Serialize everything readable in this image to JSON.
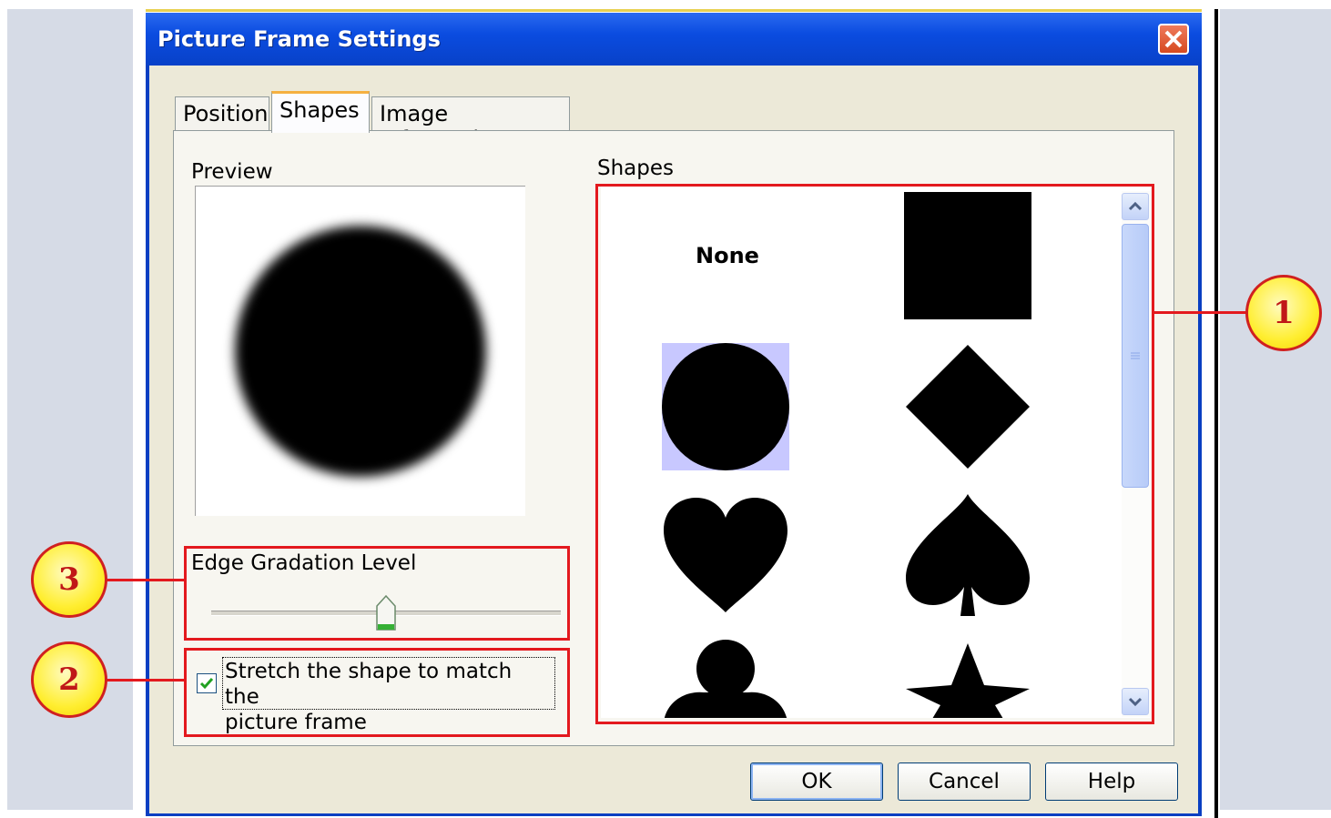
{
  "dialog": {
    "title": "Picture Frame Settings"
  },
  "tabs": [
    {
      "label": "Position",
      "active": false
    },
    {
      "label": "Shapes",
      "active": true
    },
    {
      "label": "Image Information",
      "active": false
    }
  ],
  "preview": {
    "label": "Preview"
  },
  "gradation": {
    "label": "Edge Gradation Level",
    "level_fraction": 0.5
  },
  "stretch": {
    "label_line1": "Stretch the shape to match the",
    "label_line2": "picture frame",
    "checked": true
  },
  "shapes": {
    "label": "Shapes",
    "items": [
      "None",
      "square",
      "circle",
      "diamond",
      "heart",
      "spade",
      "club",
      "star"
    ],
    "selected": "circle"
  },
  "buttons": {
    "ok": "OK",
    "cancel": "Cancel",
    "help": "Help"
  },
  "callouts": {
    "c1": "1",
    "c2": "2",
    "c3": "3"
  },
  "colors": {
    "highlight": "#e3191e",
    "title_bar": "#0b4ce0",
    "dialog_face": "#ece9d8",
    "selection": "#c8c8ff"
  }
}
